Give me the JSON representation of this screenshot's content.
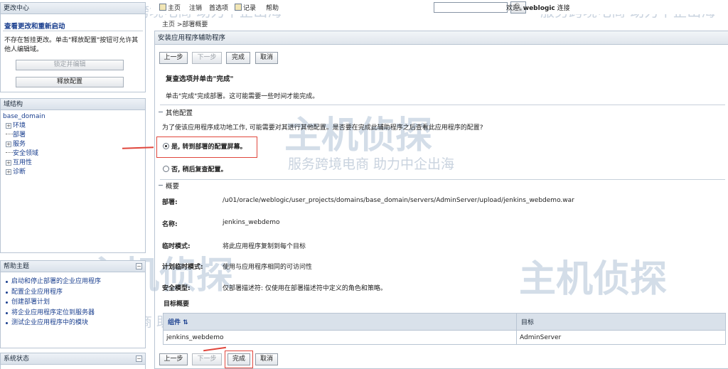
{
  "watermark": {
    "text": "服务跨境电商 助力中企出海",
    "logo": "主机侦探"
  },
  "topbar": {
    "links": [
      "主页",
      "注销",
      "首选项",
      "记录",
      "帮助"
    ],
    "search_placeholder": "",
    "search_icon": "magnifier-icon",
    "welcome_prefix": "欢迎,",
    "username": "weblogic",
    "connected": "连接"
  },
  "breadcrumb": "主页 >部署概要",
  "change_center": {
    "title": "更改中心",
    "link": "查看更改和重新启动",
    "message": "不存在暂挂更改。单击\"释放配置\"按钮可允许其他人编辑域。",
    "lock_button": "锁定并编辑",
    "release_button": "释放配置"
  },
  "domain_structure": {
    "title": "域结构",
    "root": "base_domain",
    "items": [
      {
        "label": "环境",
        "expandable": true
      },
      {
        "label": "部署",
        "expandable": false
      },
      {
        "label": "服务",
        "expandable": true
      },
      {
        "label": "安全领域",
        "expandable": false
      },
      {
        "label": "互用性",
        "expandable": true
      },
      {
        "label": "诊断",
        "expandable": true
      }
    ]
  },
  "help": {
    "title": "帮助主题",
    "items": [
      "启动和停止部署的企业应用程序",
      "配置企业应用程序",
      "创建部署计划",
      "将企业应用程序定位到服务器",
      "测试企业应用程序中的模块"
    ]
  },
  "system_status": {
    "title": "系统状态"
  },
  "main": {
    "title": "安装应用程序辅助程序",
    "buttons": {
      "back": "上一步",
      "next": "下一步",
      "finish": "完成",
      "cancel": "取消"
    },
    "heading": "复查选项并单击\"完成\"",
    "intro": "单击\"完成\"完成部署。这可能需要一些时间才能完成。",
    "other_config": {
      "title": "其他配置",
      "question": "为了使该应用程序成功地工作, 可能需要对其进行其他配置。是否要在完成此辅助程序之后查看此应用程序的配置?",
      "option_yes": "是, 转到部署的配置屏幕。",
      "option_no": "否, 稍后复查配置。",
      "selected": "yes"
    },
    "summary": {
      "title": "概要",
      "rows": [
        {
          "label": "部署:",
          "value": "/u01/oracle/weblogic/user_projects/domains/base_domain/servers/AdminServer/upload/jenkins_webdemo.war"
        },
        {
          "label": "名称:",
          "value": "jenkins_webdemo"
        },
        {
          "label": "临时模式:",
          "value": "将此应用程序复制到每个目标"
        },
        {
          "label": "计划临时模式:",
          "value": "使用与应用程序相同的可访问性"
        },
        {
          "label": "安全模型:",
          "value": "仅部署描述符: 仅使用在部署描述符中定义的角色和策略。"
        }
      ]
    },
    "target_summary": {
      "title": "目标概要",
      "columns": [
        "组件",
        "目标"
      ],
      "sort_indicator": "⇅",
      "rows": [
        [
          "jenkins_webdemo",
          "AdminServer"
        ]
      ]
    }
  },
  "colors": {
    "panel_border": "#b9c5d3",
    "link": "#1a3f8f",
    "annotation": "#e0463c"
  }
}
